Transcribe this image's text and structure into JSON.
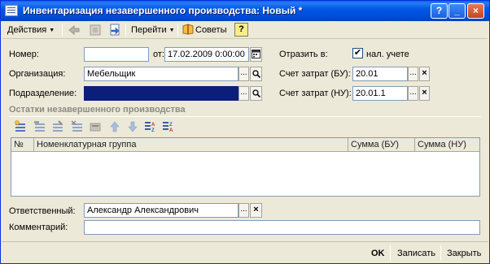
{
  "window": {
    "title": "Инвентаризация незавершенного производства: Новый *",
    "help_button": "?",
    "minimize_button": "_",
    "close_button": "×"
  },
  "toolbar": {
    "actions_label": "Действия",
    "goto_label": "Перейти",
    "tips_label": "Советы",
    "help_label": "?"
  },
  "form": {
    "number_label": "Номер:",
    "number_value": "",
    "date_label": "от:",
    "date_value": "17.02.2009  0:00:00",
    "organization_label": "Организация:",
    "organization_value": "Мебельщик",
    "department_label": "Подразделение:",
    "department_value": "",
    "reflect_label": "Отразить в:",
    "reflect_checkbox_label": "нал. учете",
    "reflect_checked": "✔",
    "account_bu_label": "Счет затрат (БУ):",
    "account_bu_value": "20.01",
    "account_nu_label": "Счет затрат (НУ):",
    "account_nu_value": "20.01.1",
    "select_button": "...",
    "search_button": "🔍",
    "clear_button": "×"
  },
  "section": {
    "title": "Остатки незавершенного производства"
  },
  "grid": {
    "columns": [
      "№",
      "Номенклатурная группа",
      "Сумма (БУ)",
      "Сумма (НУ)"
    ],
    "rows": []
  },
  "footer_fields": {
    "responsible_label": "Ответственный:",
    "responsible_value": "Александр Александрович",
    "comment_label": "Комментарий:",
    "comment_value": ""
  },
  "buttons": {
    "ok": "OK",
    "save": "Записать",
    "close": "Закрыть"
  }
}
